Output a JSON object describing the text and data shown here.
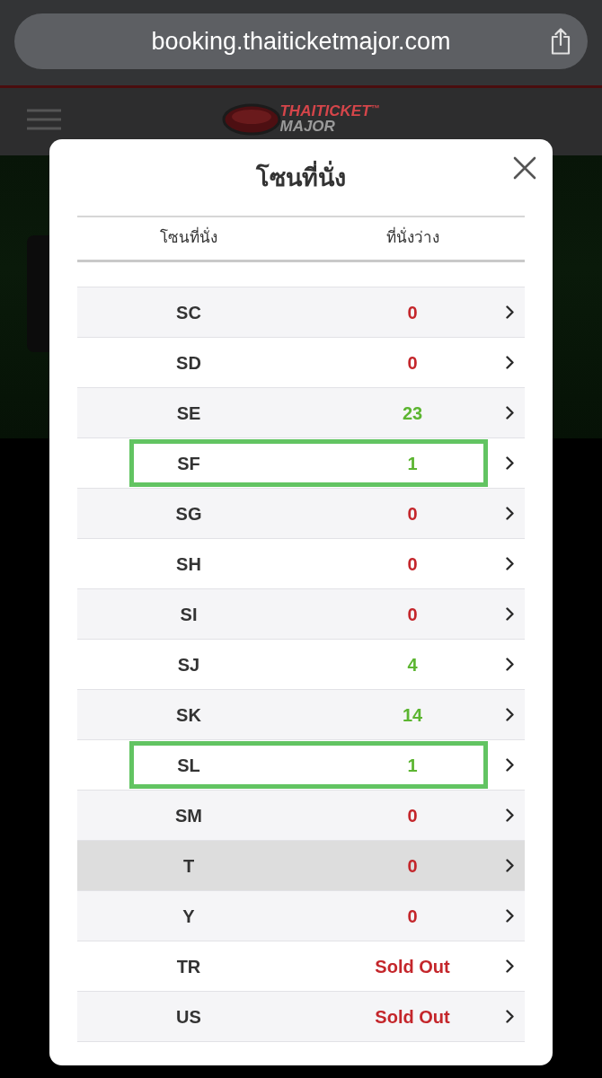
{
  "browser": {
    "url": "booking.thaiticketmajor.com"
  },
  "site_header": {
    "logo_text": "THAITICKET$^{™}$",
    "logo_subtext": "MAJOR"
  },
  "dialog": {
    "title": "โซนที่นั่ง",
    "columns": [
      "โซนที่นั่ง",
      "ที่นั่งว่าง"
    ],
    "rows": [
      {
        "zone": "SC",
        "seats": "0",
        "available": false,
        "highlighted": false,
        "active": false
      },
      {
        "zone": "SD",
        "seats": "0",
        "available": false,
        "highlighted": false,
        "active": false
      },
      {
        "zone": "SE",
        "seats": "23",
        "available": true,
        "highlighted": false,
        "active": false
      },
      {
        "zone": "SF",
        "seats": "1",
        "available": true,
        "highlighted": true,
        "active": false
      },
      {
        "zone": "SG",
        "seats": "0",
        "available": false,
        "highlighted": false,
        "active": false
      },
      {
        "zone": "SH",
        "seats": "0",
        "available": false,
        "highlighted": false,
        "active": false
      },
      {
        "zone": "SI",
        "seats": "0",
        "available": false,
        "highlighted": false,
        "active": false
      },
      {
        "zone": "SJ",
        "seats": "4",
        "available": true,
        "highlighted": false,
        "active": false
      },
      {
        "zone": "SK",
        "seats": "14",
        "available": true,
        "highlighted": false,
        "active": false
      },
      {
        "zone": "SL",
        "seats": "1",
        "available": true,
        "highlighted": true,
        "active": false
      },
      {
        "zone": "SM",
        "seats": "0",
        "available": false,
        "highlighted": false,
        "active": false
      },
      {
        "zone": "T",
        "seats": "0",
        "available": false,
        "highlighted": false,
        "active": true
      },
      {
        "zone": "Y",
        "seats": "0",
        "available": false,
        "highlighted": false,
        "active": false
      },
      {
        "zone": "TR",
        "seats": "Sold Out",
        "available": false,
        "highlighted": false,
        "active": false
      },
      {
        "zone": "US",
        "seats": "Sold Out",
        "available": false,
        "highlighted": false,
        "active": false
      }
    ]
  }
}
